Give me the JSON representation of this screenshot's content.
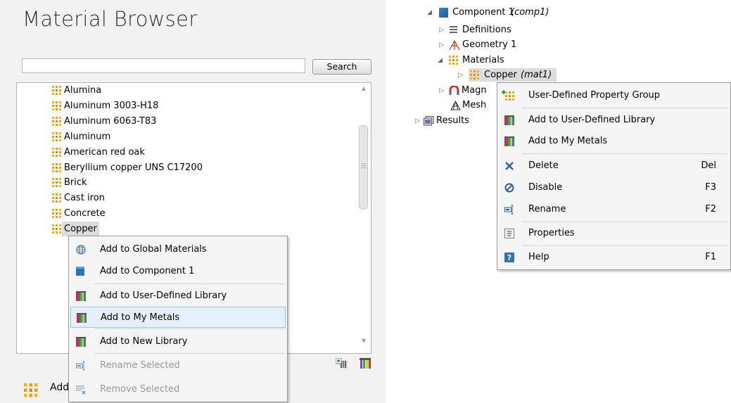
{
  "material_browser": {
    "title": "Material Browser",
    "search_value": "",
    "search_button": "Search",
    "materials": [
      "Alumina",
      "Aluminum 3003-H18",
      "Aluminum 6063-T83",
      "Aluminum",
      "American red oak",
      "Beryllium copper UNS C17200",
      "Brick",
      "Cast iron",
      "Concrete",
      "Copper"
    ],
    "selected": "Copper",
    "bottom_add_label": "Add"
  },
  "browser_context_menu": {
    "items": [
      {
        "label": "Add to Global Materials",
        "icon": "globe-icon",
        "enabled": true
      },
      {
        "label": "Add to Component 1",
        "icon": "component-icon",
        "enabled": true
      },
      {
        "label": "Add to User-Defined Library",
        "icon": "library-icon",
        "enabled": true
      },
      {
        "label": "Add to My Metals",
        "icon": "library-icon",
        "enabled": true,
        "highlighted": true
      },
      {
        "label": "Add to New Library",
        "icon": "library-icon",
        "enabled": true
      },
      {
        "label": "Rename Selected",
        "icon": "rename-icon",
        "enabled": false
      },
      {
        "label": "Remove Selected",
        "icon": "remove-list-icon",
        "enabled": false
      }
    ]
  },
  "model_tree": {
    "component": {
      "label": "Component 1",
      "tag": "(comp1)"
    },
    "definitions": "Definitions",
    "geometry": "Geometry 1",
    "materials": "Materials",
    "copper": {
      "label": "Copper",
      "tag": "(mat1)"
    },
    "magnetic_partial": "Magn",
    "mesh_partial": "Mesh",
    "results": "Results"
  },
  "tree_context_menu": {
    "items": [
      {
        "label": "User-Defined Property Group",
        "icon": "add-property-group-icon",
        "shortcut": ""
      },
      {
        "label": "Add to User-Defined Library",
        "icon": "library-icon",
        "shortcut": ""
      },
      {
        "label": "Add to My Metals",
        "icon": "library-icon",
        "shortcut": ""
      },
      {
        "label": "Delete",
        "icon": "delete-icon",
        "shortcut": "Del"
      },
      {
        "label": "Disable",
        "icon": "disable-icon",
        "shortcut": "F3"
      },
      {
        "label": "Rename",
        "icon": "rename-icon",
        "shortcut": "F2"
      },
      {
        "label": "Properties",
        "icon": "properties-icon",
        "shortcut": ""
      },
      {
        "label": "Help",
        "icon": "help-icon",
        "shortcut": "F1"
      }
    ]
  },
  "colors": {
    "material_icon": "#f0a500",
    "component_icon": "#2f72b8",
    "highlight": "#e6f0fb",
    "selected": "#dcdcdc"
  }
}
